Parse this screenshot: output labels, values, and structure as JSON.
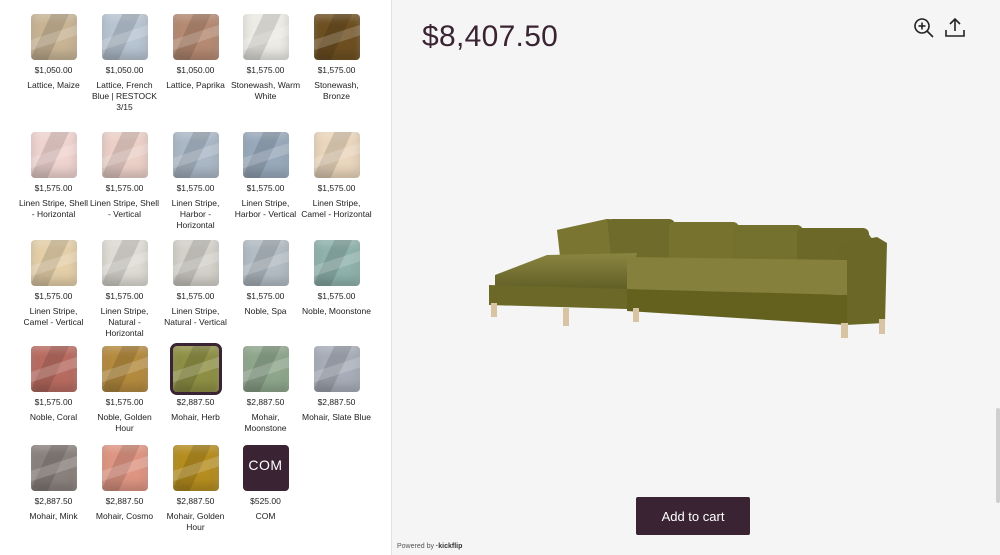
{
  "total_price": "$8,407.50",
  "add_to_cart_label": "Add to cart",
  "powered_by": {
    "prefix": "Powered by",
    "brand": "·kickflip"
  },
  "colors": {
    "accent": "#3a2333",
    "panel_bg": "#f5f5f5",
    "sofa": "#74712f"
  },
  "icons": {
    "zoom": "zoom-in-icon",
    "share": "share-icon"
  },
  "swatches": [
    {
      "price": "$1,050.00",
      "name": "Lattice, Maize",
      "color": "#c8b494"
    },
    {
      "price": "$1,050.00",
      "name": "Lattice, French Blue | RESTOCK 3/15",
      "color": "#b7c4d2"
    },
    {
      "price": "$1,050.00",
      "name": "Lattice, Paprika",
      "color": "#b58a72"
    },
    {
      "price": "$1,575.00",
      "name": "Stonewash, Warm White",
      "color": "#ecebe5"
    },
    {
      "price": "$1,575.00",
      "name": "Stonewash, Bronze",
      "color": "#6d4f21"
    },
    {
      "price": "$1,575.00",
      "name": "Linen Stripe, Shell - Horizontal",
      "color": "#efd3cf"
    },
    {
      "price": "$1,575.00",
      "name": "Linen Stripe, Shell - Vertical",
      "color": "#ebd0c8"
    },
    {
      "price": "$1,575.00",
      "name": "Linen Stripe, Harbor - Horizontal",
      "color": "#aab8c6"
    },
    {
      "price": "$1,575.00",
      "name": "Linen Stripe, Harbor - Vertical",
      "color": "#98a9bb"
    },
    {
      "price": "$1,575.00",
      "name": "Linen Stripe, Camel - Horizontal",
      "color": "#ead6bc"
    },
    {
      "price": "$1,575.00",
      "name": "Linen Stripe, Camel - Vertical",
      "color": "#e4cfa8"
    },
    {
      "price": "$1,575.00",
      "name": "Linen Stripe, Natural - Horizontal",
      "color": "#dedbd4"
    },
    {
      "price": "$1,575.00",
      "name": "Linen Stripe, Natural - Vertical",
      "color": "#d4d1ca"
    },
    {
      "price": "$1,575.00",
      "name": "Noble, Spa",
      "color": "#b2bcc4"
    },
    {
      "price": "$1,575.00",
      "name": "Noble, Moonstone",
      "color": "#8fb2ac"
    },
    {
      "price": "$1,575.00",
      "name": "Noble, Coral",
      "color": "#b86b60"
    },
    {
      "price": "$1,575.00",
      "name": "Noble, Golden Hour",
      "color": "#b48a3e"
    },
    {
      "price": "$2,887.50",
      "name": "Mohair, Herb",
      "color": "#8e8f44",
      "selected": true
    },
    {
      "price": "$2,887.50",
      "name": "Mohair, Moonstone",
      "color": "#8ea68c"
    },
    {
      "price": "$2,887.50",
      "name": "Mohair, Slate Blue",
      "color": "#a7adb8"
    },
    {
      "price": "$2,887.50",
      "name": "Mohair, Mink",
      "color": "#8a817c"
    },
    {
      "price": "$2,887.50",
      "name": "Mohair, Cosmo",
      "color": "#de9582"
    },
    {
      "price": "$2,887.50",
      "name": "Mohair, Golden Hour",
      "color": "#b58d1f"
    },
    {
      "price": "$525.00",
      "name": "COM",
      "color": "#3a2333",
      "badge": "COM"
    }
  ]
}
